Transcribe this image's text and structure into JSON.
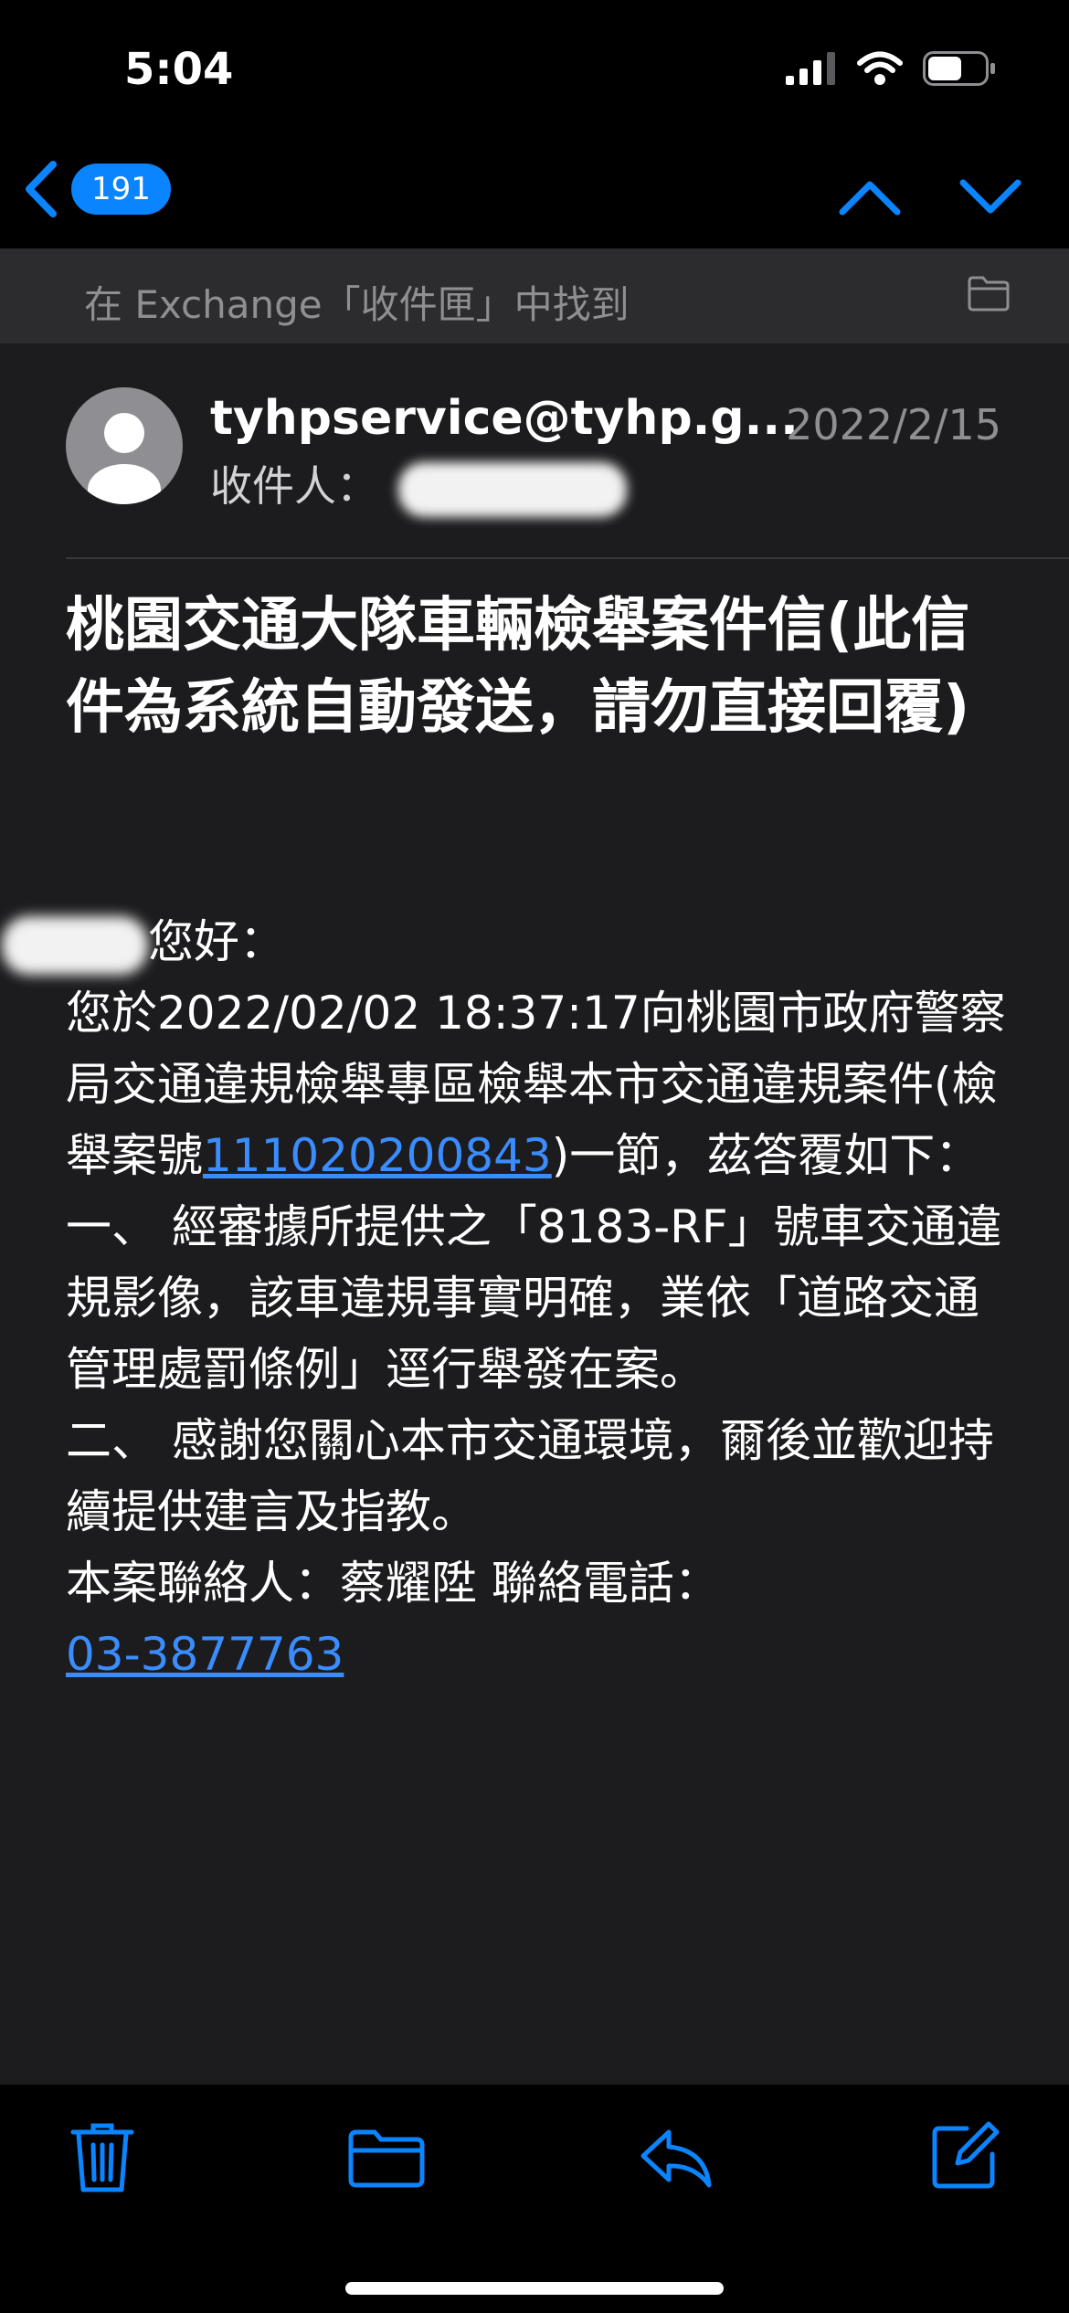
{
  "status": {
    "time": "5:04"
  },
  "nav": {
    "badge_count": "191"
  },
  "location": {
    "found_in": "在 Exchange「收件匣」中找到"
  },
  "email": {
    "sender": "tyhpservice@tyhp.g...",
    "date": "2022/2/15",
    "recipient_label": "收件人：",
    "subject": "桃園交通大隊車輛檢舉案件信(此信件為系統自動發送，請勿直接回覆)",
    "greeting": "您好：",
    "line1_before": "您於2022/02/02 18:37:17向桃園市政府警察局交通違規檢舉專區檢舉本市交通違規案件(檢舉案號",
    "case_number": "111020200843",
    "line1_after": ")一節，茲答覆如下：",
    "item1": "一、 經審據所提供之「8183-RF」號車交通違規影像，該車違規事實明確，業依「道路交通管理處罰條例」逕行舉發在案。",
    "item2": "二、 感謝您關心本市交通環境，爾後並歡迎持續提供建言及指教。",
    "contact": "本案聯絡人：蔡耀陞 聯絡電話：",
    "phone": "03-3877763"
  },
  "colors": {
    "accent": "#0a84ff",
    "link": "#3a8dff",
    "background": "#1c1c1e"
  },
  "icons": [
    "back-chevron-icon",
    "up-chevron-icon",
    "down-chevron-icon",
    "folder-icon",
    "trash-icon",
    "reply-icon",
    "compose-icon",
    "signal-icon",
    "wifi-icon",
    "battery-icon"
  ]
}
